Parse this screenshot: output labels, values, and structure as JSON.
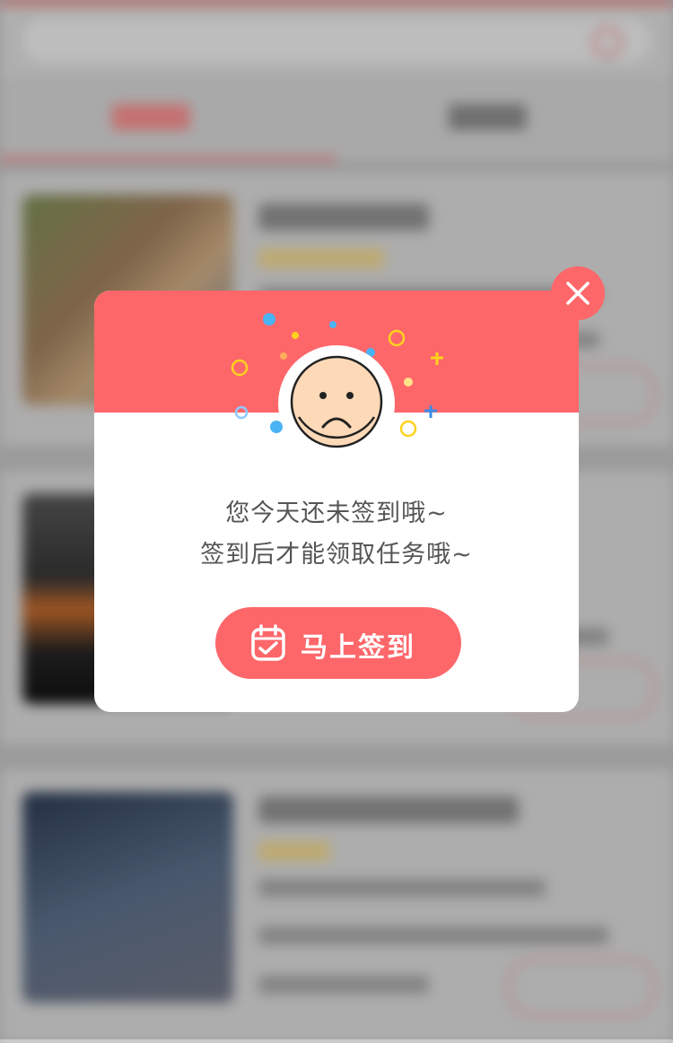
{
  "modal": {
    "line1": "您今天还未签到哦~",
    "line2": "签到后才能领取任务哦~",
    "button_label": "马上签到"
  },
  "colors": {
    "accent": "#fe676a",
    "face": "#fdd9b8",
    "confetti_blue": "#4ab3f4",
    "confetti_yellow": "#ffd21f"
  },
  "icons": {
    "close": "close-icon",
    "face": "sad-face-icon",
    "calendar": "calendar-check-icon"
  }
}
